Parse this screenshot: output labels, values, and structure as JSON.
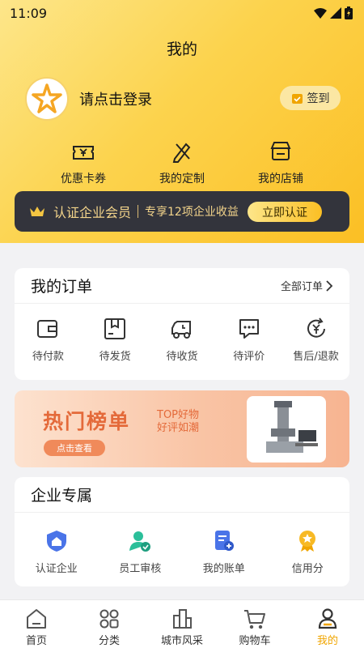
{
  "status_bar": {
    "time": "11:09"
  },
  "header": {
    "title": "我的",
    "login_text": "请点击登录",
    "signin_label": "签到"
  },
  "quick_actions": [
    {
      "label": "优惠卡券",
      "icon": "coupon-icon"
    },
    {
      "label": "我的定制",
      "icon": "customize-icon"
    },
    {
      "label": "我的店铺",
      "icon": "shop-icon"
    }
  ],
  "vip": {
    "title": "认证企业会员",
    "subtitle": "专享12项企业收益",
    "button": "立即认证"
  },
  "orders": {
    "title": "我的订单",
    "more": "全部订单",
    "items": [
      {
        "label": "待付款",
        "icon": "wallet-icon"
      },
      {
        "label": "待发货",
        "icon": "package-icon"
      },
      {
        "label": "待收货",
        "icon": "truck-icon"
      },
      {
        "label": "待评价",
        "icon": "comment-icon"
      },
      {
        "label": "售后/退款",
        "icon": "refund-icon"
      }
    ]
  },
  "banner": {
    "title": "热门榜单",
    "line1": "TOP好物",
    "line2": "好评如潮",
    "button": "点击查看"
  },
  "enterprise": {
    "title": "企业专属",
    "items": [
      {
        "label": "认证企业",
        "icon": "enterprise-cert-icon"
      },
      {
        "label": "员工审核",
        "icon": "staff-review-icon"
      },
      {
        "label": "我的账单",
        "icon": "bill-icon"
      },
      {
        "label": "信用分",
        "icon": "credit-icon"
      }
    ]
  },
  "tabbar": [
    {
      "label": "首页",
      "icon": "home-icon"
    },
    {
      "label": "分类",
      "icon": "category-icon"
    },
    {
      "label": "城市风采",
      "icon": "city-icon"
    },
    {
      "label": "购物车",
      "icon": "cart-icon"
    },
    {
      "label": "我的",
      "icon": "profile-icon",
      "active": true
    }
  ],
  "colors": {
    "accent": "#fbbf24",
    "active_tab": "#f0a500",
    "vip_bg": "#33343c",
    "vip_text": "#f4d58b",
    "banner_text": "#e46a3a"
  }
}
